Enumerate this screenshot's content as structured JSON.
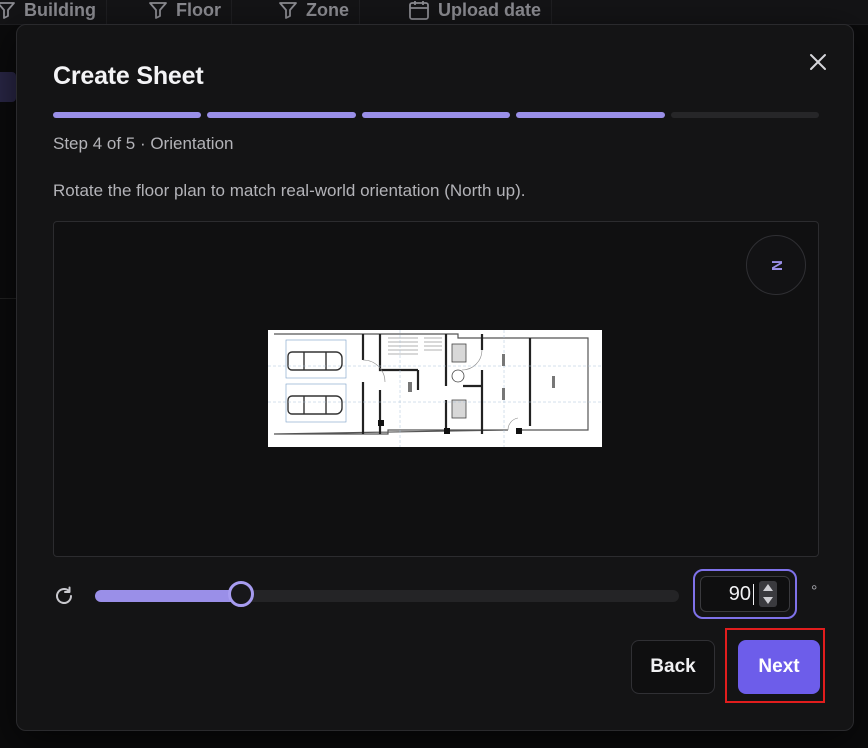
{
  "background": {
    "filters": [
      {
        "label": "Building",
        "icon": "filter-icon"
      },
      {
        "label": "Floor",
        "icon": "filter-icon"
      },
      {
        "label": "Zone",
        "icon": "filter-icon"
      },
      {
        "label": "Upload date",
        "icon": "calendar-icon"
      }
    ]
  },
  "modal": {
    "title": "Create Sheet",
    "close_icon": "close-icon",
    "progress": {
      "total_steps": 5,
      "completed_steps": 4,
      "accent": "#9a8fe8"
    },
    "step_label": "Step 4 of 5 · Orientation",
    "instruction": "Rotate the floor plan to match real-world orientation (North up).",
    "compass_label": "N",
    "rotation": {
      "value": "90",
      "unit": "°",
      "min": 0,
      "max": 360,
      "fraction": 0.25,
      "reset_icon": "rotate-reset-icon"
    },
    "buttons": {
      "back": "Back",
      "next": "Next"
    },
    "colors": {
      "accent": "#6d5dea",
      "highlight": "#e11d1d"
    }
  }
}
